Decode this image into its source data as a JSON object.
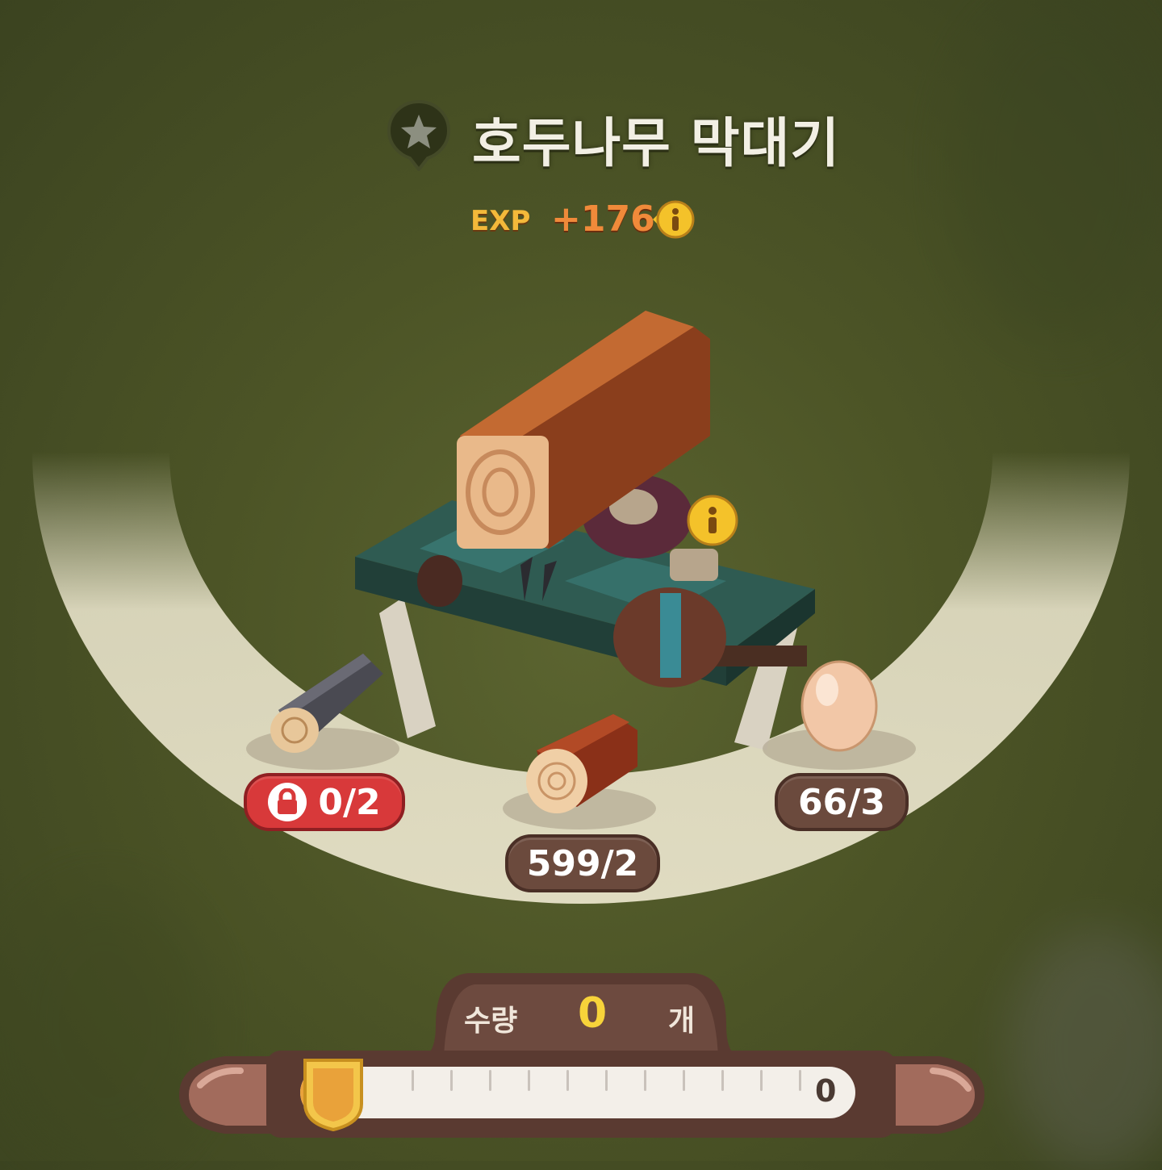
{
  "item": {
    "title": "호두나무 막대기",
    "exp_label": "EXP",
    "exp_value": "+176"
  },
  "ingredients": [
    {
      "name": "dark-log",
      "count": "0/2",
      "insufficient": true
    },
    {
      "name": "walnut-log",
      "count": "599/2",
      "insufficient": false
    },
    {
      "name": "egg",
      "count": "66/3",
      "insufficient": false
    }
  ],
  "quantity": {
    "label": "수량",
    "value": "0",
    "unit": "개",
    "slider_max_label": "0",
    "slider_fraction": 0
  },
  "colors": {
    "background": "#4c5426",
    "ring": "#e7e2c9",
    "pill": "#6b4a3d",
    "pill_red": "#d8393a",
    "accent_yellow": "#f7d33a"
  }
}
